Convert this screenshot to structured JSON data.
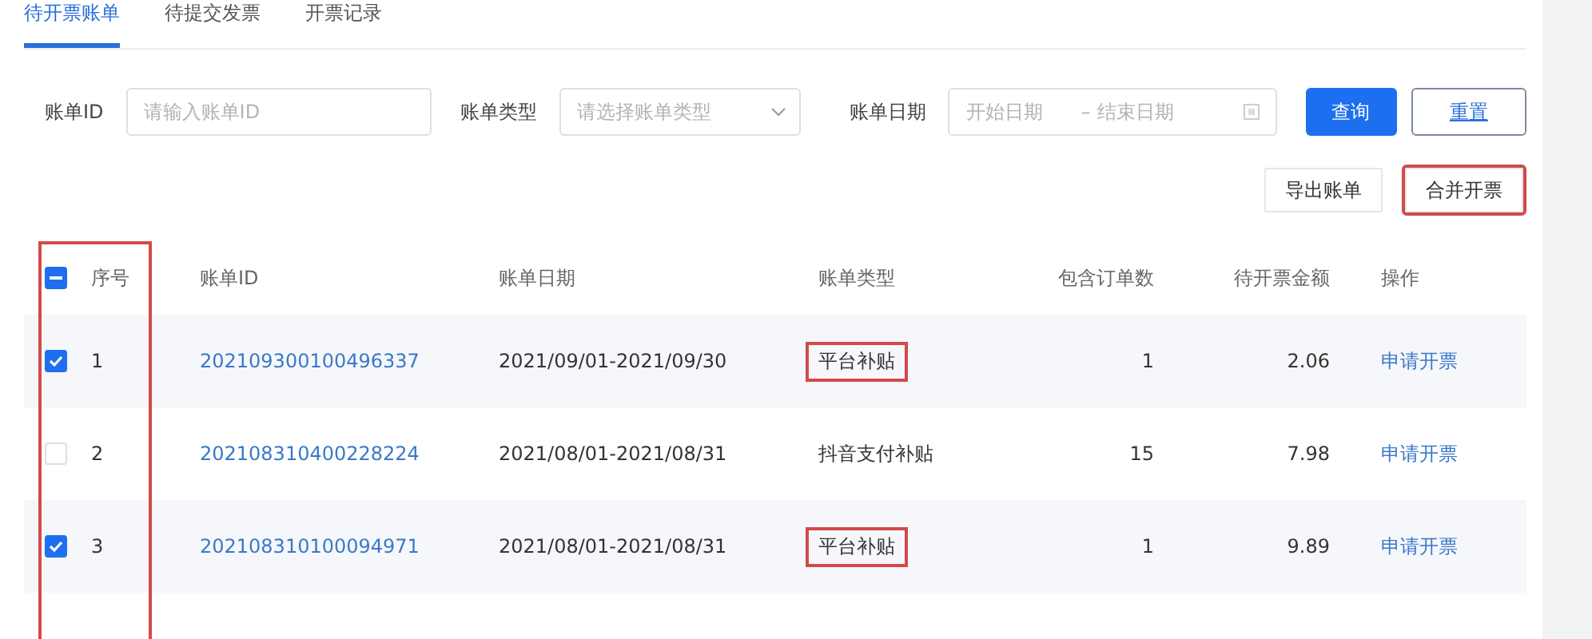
{
  "tabs": [
    {
      "label": "待开票账单",
      "selected": true
    },
    {
      "label": "待提交发票",
      "selected": false
    },
    {
      "label": "开票记录",
      "selected": false
    }
  ],
  "filters": {
    "bill_id": {
      "label": "账单ID",
      "placeholder": "请输入账单ID"
    },
    "bill_type": {
      "label": "账单类型",
      "placeholder": "请选择账单类型"
    },
    "bill_date": {
      "label": "账单日期",
      "start_placeholder": "开始日期",
      "separator": "–",
      "end_placeholder": "结束日期"
    },
    "buttons": [
      {
        "label": "查询",
        "kind": "primary"
      },
      {
        "label": "重置",
        "kind": "outline"
      }
    ]
  },
  "actions": [
    {
      "label": "导出账单",
      "highlighted": false
    },
    {
      "label": "合并开票",
      "highlighted": true
    }
  ],
  "table": {
    "select_all_indeterminate": true,
    "columns": [
      "序号",
      "账单ID",
      "账单日期",
      "账单类型",
      "包含订单数",
      "待开票金额",
      "操作"
    ],
    "rows": [
      {
        "checked": true,
        "index": "1",
        "bill_id": "202109300100496337",
        "date": "2021/09/01-2021/09/30",
        "type": "平台补贴",
        "type_highlighted": true,
        "orders": "1",
        "amount": "2.06",
        "action": "申请开票"
      },
      {
        "checked": false,
        "index": "2",
        "bill_id": "202108310400228224",
        "date": "2021/08/01-2021/08/31",
        "type": "抖音支付补贴",
        "type_highlighted": false,
        "orders": "15",
        "amount": "7.98",
        "action": "申请开票"
      },
      {
        "checked": true,
        "index": "3",
        "bill_id": "202108310100094971",
        "date": "2021/08/01-2021/08/31",
        "type": "平台补贴",
        "type_highlighted": true,
        "orders": "1",
        "amount": "9.89",
        "action": "申请开票"
      }
    ]
  }
}
